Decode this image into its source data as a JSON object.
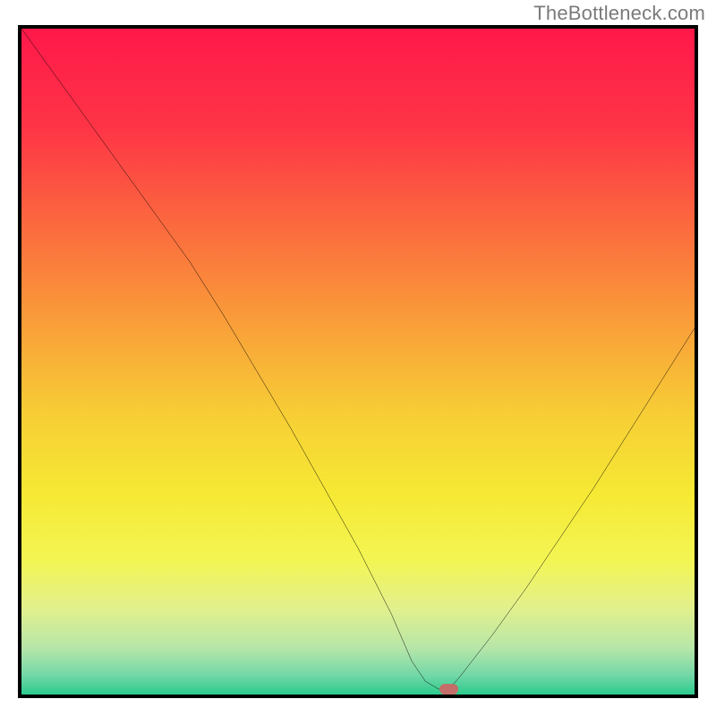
{
  "watermark": "TheBottleneck.com",
  "chart_data": {
    "type": "line",
    "title": "",
    "xlabel": "",
    "ylabel": "",
    "xlim": [
      0,
      100
    ],
    "ylim": [
      0,
      100
    ],
    "grid": false,
    "series": [
      {
        "name": "curve",
        "x": [
          0,
          5,
          10,
          15,
          20,
          25,
          30,
          35,
          40,
          45,
          50,
          55,
          58,
          60,
          62,
          63.5,
          65,
          70,
          75,
          80,
          85,
          90,
          95,
          100
        ],
        "y": [
          100,
          93,
          86,
          79,
          72,
          65,
          57,
          48.5,
          40,
          31,
          22,
          12,
          5,
          2,
          0.8,
          0.8,
          2.5,
          9,
          16,
          23.5,
          31,
          39,
          47,
          55
        ]
      }
    ],
    "gradient_stops": [
      {
        "offset": 0,
        "color": "#ff184a"
      },
      {
        "offset": 15,
        "color": "#fe3546"
      },
      {
        "offset": 30,
        "color": "#fb6b3e"
      },
      {
        "offset": 45,
        "color": "#f9a139"
      },
      {
        "offset": 58,
        "color": "#f7ce35"
      },
      {
        "offset": 70,
        "color": "#f6e934"
      },
      {
        "offset": 80,
        "color": "#f3f554"
      },
      {
        "offset": 87,
        "color": "#e2f08d"
      },
      {
        "offset": 93,
        "color": "#b7e6a8"
      },
      {
        "offset": 97,
        "color": "#75d8a8"
      },
      {
        "offset": 100,
        "color": "#2ccb8e"
      }
    ],
    "bottleneck_marker": {
      "x": 63.5,
      "y": 0.8,
      "color": "#c56d68"
    }
  }
}
